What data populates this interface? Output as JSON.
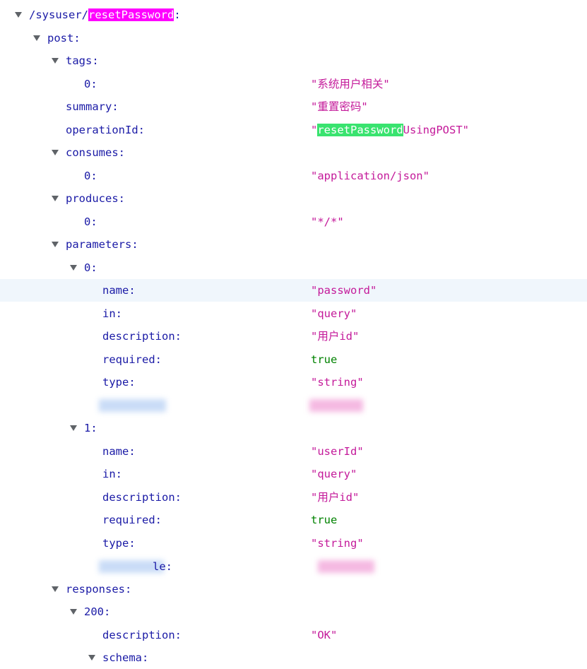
{
  "path": {
    "prefix": "/sysuser/",
    "highlighted": "resetPassword",
    "suffix": ":"
  },
  "post": {
    "key": "post:"
  },
  "tags": {
    "key": "tags:",
    "items": [
      {
        "index": "0:",
        "value": "\"系统用户相关\""
      }
    ]
  },
  "summary": {
    "key": "summary:",
    "value": "\"重置密码\""
  },
  "operationId": {
    "key": "operationId:",
    "quote_open": "\"",
    "highlighted": "resetPassword",
    "rest": "UsingPOST\""
  },
  "consumes": {
    "key": "consumes:",
    "items": [
      {
        "index": "0:",
        "value": "\"application/json\""
      }
    ]
  },
  "produces": {
    "key": "produces:",
    "items": [
      {
        "index": "0:",
        "value": "\"*/*\""
      }
    ]
  },
  "parameters": {
    "key": "parameters:",
    "items": [
      {
        "index": "0:",
        "fields": [
          {
            "key": "name:",
            "value": "\"password\""
          },
          {
            "key": "in:",
            "value": "\"query\""
          },
          {
            "key": "description:",
            "value": "\"用户id\""
          },
          {
            "key": "required:",
            "value": "true"
          },
          {
            "key": "type:",
            "value": "\"string\""
          }
        ]
      },
      {
        "index": "1:",
        "fields": [
          {
            "key": "name:",
            "value": "\"userId\""
          },
          {
            "key": "in:",
            "value": "\"query\""
          },
          {
            "key": "description:",
            "value": "\"用户id\""
          },
          {
            "key": "required:",
            "value": "true"
          },
          {
            "key": "type:",
            "value": "\"string\""
          }
        ],
        "partial_key": "le:"
      }
    ]
  },
  "responses": {
    "key": "responses:",
    "code": "200:",
    "description_key": "description:",
    "description_value": "\"OK\"",
    "schema_key": "schema:"
  },
  "colors": {
    "key": "#1a1aa6",
    "string": "#c41a9a",
    "boolean": "#008200",
    "highlight_pink": "#ff00ff",
    "highlight_green": "#39e36f"
  }
}
